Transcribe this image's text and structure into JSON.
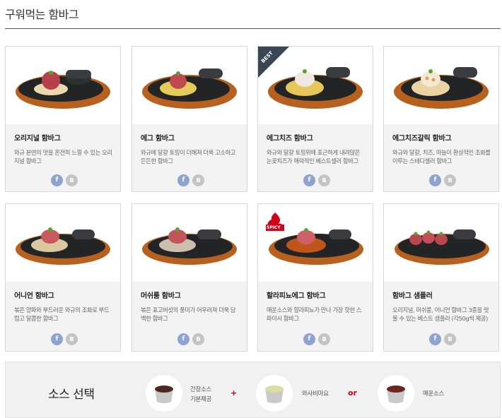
{
  "page": {
    "title": "구워먹는 함바그"
  },
  "colors": {
    "accent": "#d0021b",
    "facebook": "#8ea3cf",
    "blog": "#c4c4c4",
    "best_badge": "#3b4652",
    "card_bg": "#f3f3f3"
  },
  "products": [
    {
      "name": "오리지널 함바그",
      "desc": "와규 본연의 맛을 온전히 느낄 수 있는 오리지널 함바그",
      "badge": "",
      "icon": "hamburg-plate-original"
    },
    {
      "name": "에그 함바그",
      "desc": "와규에 달걀 토핑이 더해져 더욱 고소하고 든든한 함바그",
      "badge": "",
      "icon": "hamburg-plate-egg"
    },
    {
      "name": "에그치즈 함바그",
      "desc": "와규와 달걀 토핑위에 포근하게 내려앉은 눈꽃치즈가 매력적인 베스트셀러 함바그",
      "badge": "BEST",
      "icon": "hamburg-plate-egg-cheese"
    },
    {
      "name": "에그치즈갈릭 함바그",
      "desc": "와규와 달걀, 치즈, 마늘이 환상적인 조화를 이루는 스테디셀러 함바그",
      "badge": "",
      "icon": "hamburg-plate-egg-cheese-garlic"
    },
    {
      "name": "어니언 함바그",
      "desc": "볶은 양파와 부드러운 와규의 조화로 부드럽고 달콤한 함바그",
      "badge": "",
      "icon": "hamburg-plate-onion"
    },
    {
      "name": "머쉬룸 함바그",
      "desc": "볶은 표고버섯의 풍미가 어우러져 더욱 담백한 함바그",
      "badge": "",
      "icon": "hamburg-plate-mushroom"
    },
    {
      "name": "할라피뇨에그 함바그",
      "desc": "매운소스와 할라피뇨가 만나 가장 핫한 스파이시 함바그",
      "badge": "SPICY",
      "icon": "hamburg-plate-jalapeno"
    },
    {
      "name": "함바그 샘플러",
      "desc": "오리지널, 머쉬룸, 어니언 함바그 3종을 맛볼 수 있는 베스트 샘플러 (각50g씩 제공)",
      "badge": "",
      "icon": "hamburg-plate-sampler"
    }
  ],
  "share": {
    "facebook_label": "f",
    "blog_label": "B"
  },
  "sauce": {
    "heading": "소스 선택",
    "items": [
      {
        "label_line1": "간장소스",
        "label_line2": "기본제공",
        "color": "#4a2a22"
      },
      {
        "label_line1": "와사비마요",
        "label_line2": "",
        "color": "#d8dfa4"
      },
      {
        "label_line1": "매운소스",
        "label_line2": "",
        "color": "#6e2521"
      }
    ],
    "plus": "+",
    "or": "or"
  }
}
